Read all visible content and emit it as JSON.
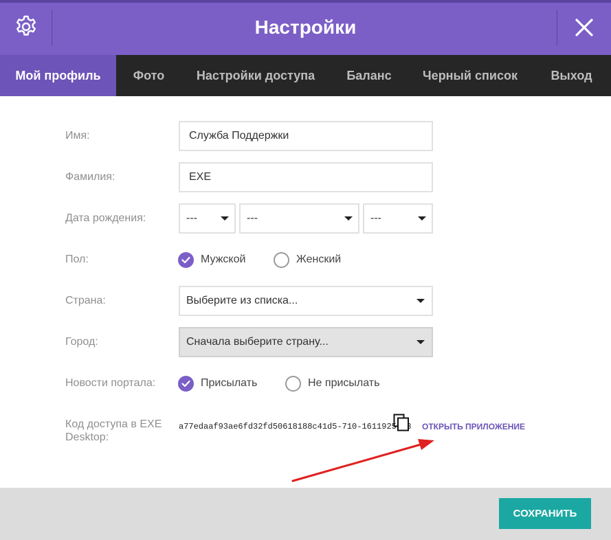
{
  "header": {
    "title": "Настройки",
    "settings_icon": "gear-icon",
    "close_icon": "close-icon"
  },
  "tabs": [
    {
      "label": "Мой профиль",
      "active": true
    },
    {
      "label": "Фото",
      "active": false
    },
    {
      "label": "Настройки доступа",
      "active": false
    },
    {
      "label": "Баланс",
      "active": false
    },
    {
      "label": "Черный список",
      "active": false
    },
    {
      "label": "Выход",
      "active": false
    }
  ],
  "form": {
    "first_name": {
      "label": "Имя:",
      "value": "Служба Поддержки"
    },
    "last_name": {
      "label": "Фамилия:",
      "value": "EXE"
    },
    "birth_date": {
      "label": "Дата рождения:",
      "day": "---",
      "month": "---",
      "year": "---"
    },
    "gender": {
      "label": "Пол:",
      "options": [
        {
          "label": "Мужской",
          "checked": true
        },
        {
          "label": "Женский",
          "checked": false
        }
      ]
    },
    "country": {
      "label": "Страна:",
      "value": "Выберите из списка..."
    },
    "city": {
      "label": "Город:",
      "value": "Сначала выберите страну...",
      "disabled": true
    },
    "news": {
      "label": "Новости портала:",
      "options": [
        {
          "label": "Присылать",
          "checked": true
        },
        {
          "label": "Не присылать",
          "checked": false
        }
      ]
    },
    "access_code": {
      "label": "Код доступа в EXE Desktop:",
      "value": "a77edaaf93ae6fd32fd50618188c41d5-710-1611925083",
      "copy_icon": "copy-icon",
      "open_link": "ОТКРЫТЬ ПРИЛОЖЕНИЕ"
    }
  },
  "footer": {
    "save_label": "СОХРАНИТЬ"
  },
  "colors": {
    "header": "#7b5fc7",
    "active_tab": "#6c54b8",
    "tabs_bar": "#262626",
    "save_button": "#1ca8a2",
    "annotation_arrow": "#e02020"
  }
}
